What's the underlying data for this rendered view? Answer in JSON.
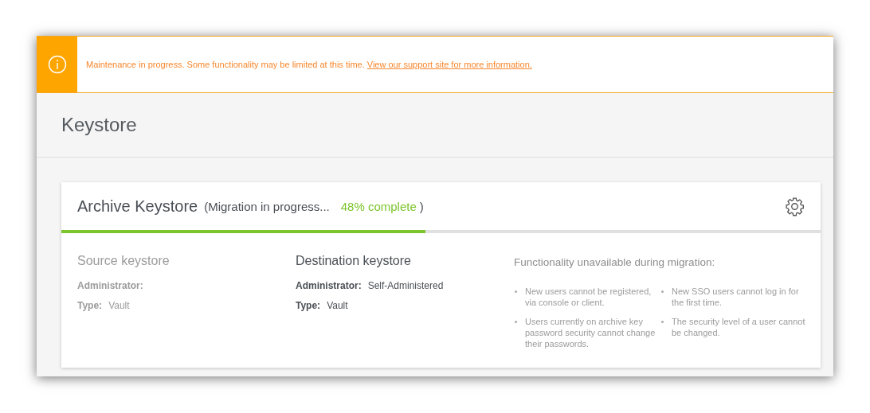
{
  "banner": {
    "message": "Maintenance in progress. Some functionality may be limited at this time.",
    "link": "View our support site for more information."
  },
  "page_title": "Keystore",
  "card": {
    "title": "Archive Keystore",
    "status_open": "(Migration in progress...",
    "percent": "48% complete",
    "status_close": ")",
    "progress": {
      "level": 0.48
    },
    "keystores": [
      {
        "heading": "Source keystore",
        "muted": true,
        "fields": [
          {
            "label": "Administrator:"
          },
          {
            "label": "Type:",
            "value": "Vault"
          }
        ]
      },
      {
        "heading": "Destination keystore",
        "muted": false,
        "fields": [
          {
            "label": "Administrator:",
            "value": "Self-Administered"
          },
          {
            "label": "Type:",
            "value": "Vault"
          }
        ]
      }
    ],
    "unavailable": {
      "heading": "Functionality unavailable during migration:",
      "items": [
        "New users cannot be registered, via console or client.",
        "New SSO users cannot log in for the first time.",
        "Users currently on archive key password security cannot change their passwords.",
        "The security level of a user cannot be changed."
      ]
    }
  }
}
